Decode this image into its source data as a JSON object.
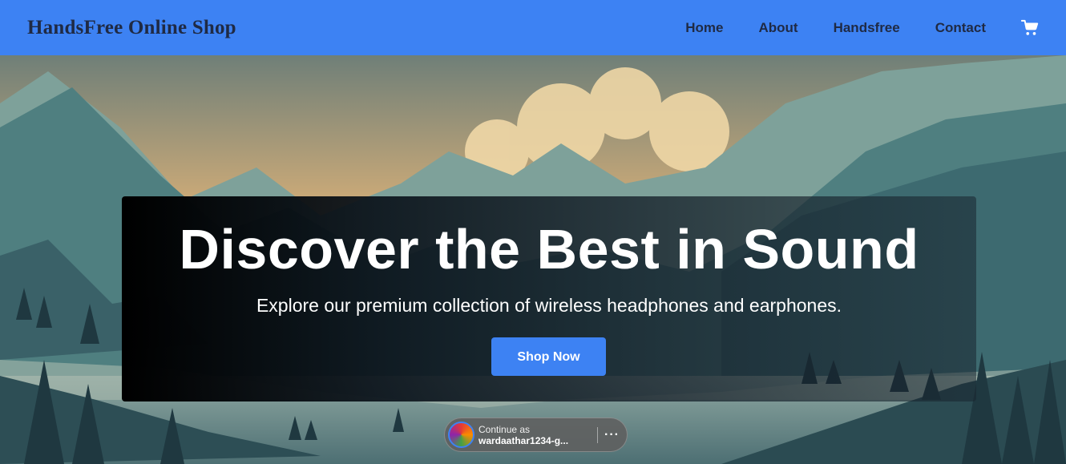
{
  "header": {
    "brand": "HandsFree Online Shop",
    "nav": [
      {
        "label": "Home"
      },
      {
        "label": "About"
      },
      {
        "label": "Handsfree"
      },
      {
        "label": "Contact"
      }
    ],
    "cart_icon": "shopping-cart-icon",
    "bg_color": "#3d82f3"
  },
  "hero": {
    "title": "Discover the Best in Sound",
    "subtitle": "Explore our premium collection of wireless headphones and earphones.",
    "cta_label": "Shop Now",
    "cta_color": "#3d82f3"
  },
  "signin_prompt": {
    "label": "Continue as",
    "user": "wardaathar1234-g...",
    "more_label": "···"
  }
}
